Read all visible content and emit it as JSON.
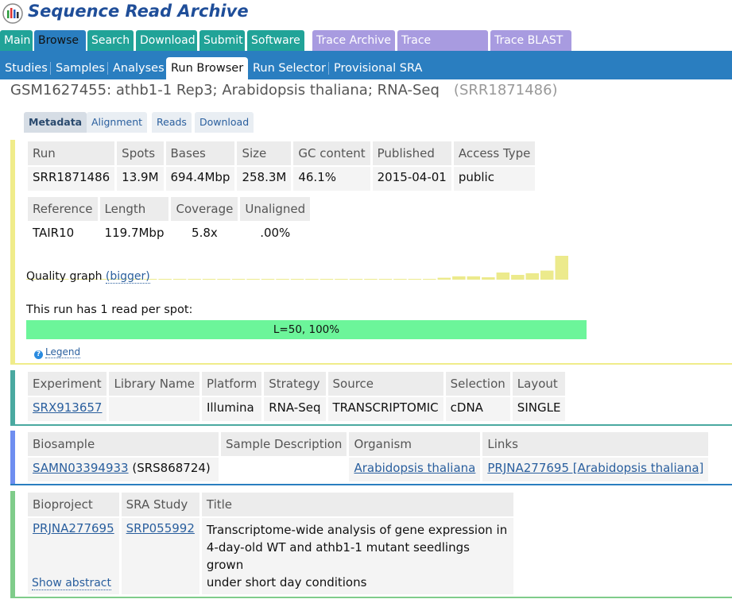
{
  "brand": {
    "name": "Sequence Read Archive"
  },
  "topnav": [
    {
      "label": "Main"
    },
    {
      "label": "Browse"
    },
    {
      "label": "Search"
    },
    {
      "label": "Download"
    },
    {
      "label": "Submit"
    },
    {
      "label": "Software"
    },
    {
      "label": "Trace Archive"
    },
    {
      "label": "Trace Assembly"
    },
    {
      "label": "Trace BLAST"
    }
  ],
  "subnav": [
    {
      "label": "Studies"
    },
    {
      "label": "Samples"
    },
    {
      "label": "Analyses"
    },
    {
      "label": "Run Browser"
    },
    {
      "label": "Run Selector"
    },
    {
      "label": "Provisional SRA"
    }
  ],
  "page": {
    "title": "GSM1627455: athb1-1 Rep3; Arabidopsis thaliana; RNA-Seq",
    "accession": "(SRR1871486)"
  },
  "tabs": [
    {
      "label": "Metadata"
    },
    {
      "label": "Alignment"
    },
    {
      "label": "Reads"
    },
    {
      "label": "Download"
    }
  ],
  "run_table": {
    "headers": [
      "Run",
      "Spots",
      "Bases",
      "Size",
      "GC content",
      "Published",
      "Access Type"
    ],
    "row": [
      "SRR1871486",
      "13.9M",
      "694.4Mbp",
      "258.3M",
      "46.1%",
      "2015-04-01",
      "public"
    ]
  },
  "ref_table": {
    "headers": [
      "Reference",
      "Length",
      "Coverage",
      "Unaligned"
    ],
    "row": [
      "TAIR10",
      "119.7Mbp",
      "5.8x",
      ".00%"
    ]
  },
  "quality": {
    "label": "Quality graph",
    "link": "(bigger)",
    "bars": [
      0,
      0,
      0,
      0,
      0,
      0,
      0,
      0,
      0,
      0,
      0,
      0,
      0,
      0,
      0,
      0,
      0,
      0,
      0,
      0,
      0,
      0,
      0,
      0,
      0,
      0.02,
      0,
      0.03,
      0.08,
      0.14,
      0.14,
      0.1,
      0.3,
      0.2,
      0.27,
      0.38,
      1.0
    ]
  },
  "reads": {
    "label": "This run has 1 read per spot:",
    "bar_label": "L=50, 100%",
    "legend": "Legend",
    "bar_color": "#6cf59a"
  },
  "exp_table": {
    "headers": [
      "Experiment",
      "Library Name",
      "Platform",
      "Strategy",
      "Source",
      "Selection",
      "Layout"
    ],
    "row": [
      "SRX913657",
      "",
      "Illumina",
      "RNA-Seq",
      "TRANSCRIPTOMIC",
      "cDNA",
      "SINGLE"
    ]
  },
  "bio_table": {
    "headers": [
      "Biosample",
      "Sample Description",
      "Organism",
      "Links"
    ],
    "biosample": "SAMN03394933",
    "biosample_extra": " (SRS868724)",
    "description": "",
    "organism": "Arabidopsis thaliana",
    "links": "PRJNA277695 [Arabidopsis thaliana]"
  },
  "proj_table": {
    "headers": [
      "Bioproject",
      "SRA Study",
      "Title"
    ],
    "bioproject": "PRJNA277695",
    "study": "SRP055992",
    "title_lines": [
      "Transcriptome-wide analysis of gene expression in",
      "4-day-old WT and athb1-1 mutant seedlings grown",
      "under short day conditions"
    ]
  },
  "show_abstract": "Show abstract",
  "colors": {
    "teal": "#21a398",
    "blue": "#2a7ec0",
    "purple": "#a89be0",
    "yellow": "#f0ec8a",
    "teal_bar": "#4aa9a0",
    "blue_bar": "#6e8ef0",
    "green_bar": "#7fcc8a"
  }
}
